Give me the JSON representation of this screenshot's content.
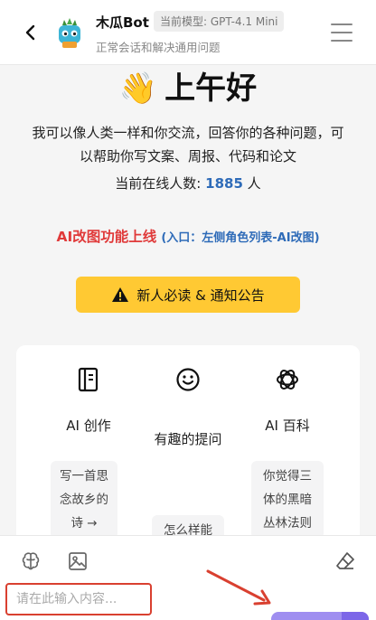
{
  "header": {
    "bot_name": "木瓜Bot",
    "model_label": "当前模型: GPT-4.1 Mini",
    "subtitle": "正常会话和解决通用问题",
    "back_icon": "chevron-left-icon",
    "menu_icon": "hamburger-menu-icon"
  },
  "greeting": {
    "emoji": "👋",
    "text": "上午好"
  },
  "intro": {
    "line1": "我可以像人类一样和你交流，回答你的各种问题，可",
    "line2": "以帮助你写文案、周报、代码和论文"
  },
  "online": {
    "prefix": "当前在线人数:",
    "count": "1885",
    "suffix": "人"
  },
  "promo": {
    "main": "AI改图功能上线",
    "sub": "(入口：左侧角色列表-AI改图)"
  },
  "notice": {
    "label": "新人必读 & 通知公告",
    "icon": "warning-icon"
  },
  "features": [
    {
      "title": "AI 创作",
      "icon": "notebook-icon",
      "prompt": [
        "写一首思",
        "念故乡的",
        "诗 →"
      ]
    },
    {
      "title": "有趣的提问",
      "icon": "smile-icon",
      "prompt": [
        "怎么样能"
      ]
    },
    {
      "title": "AI 百科",
      "icon": "openai-icon",
      "prompt": [
        "你觉得三",
        "体的黑暗",
        "丛林法则"
      ]
    }
  ],
  "input": {
    "placeholder": "请在此输入内容...",
    "value": ""
  },
  "toolbar": {
    "brain_icon": "brain-icon",
    "image_icon": "image-icon",
    "eraser_icon": "eraser-icon"
  },
  "colors": {
    "accent_red": "#e03a3a",
    "accent_blue": "#2e6bb8",
    "notice_yellow": "#ffc933",
    "send_purple": "#9f8ef0",
    "annotation_red": "#d94030"
  }
}
